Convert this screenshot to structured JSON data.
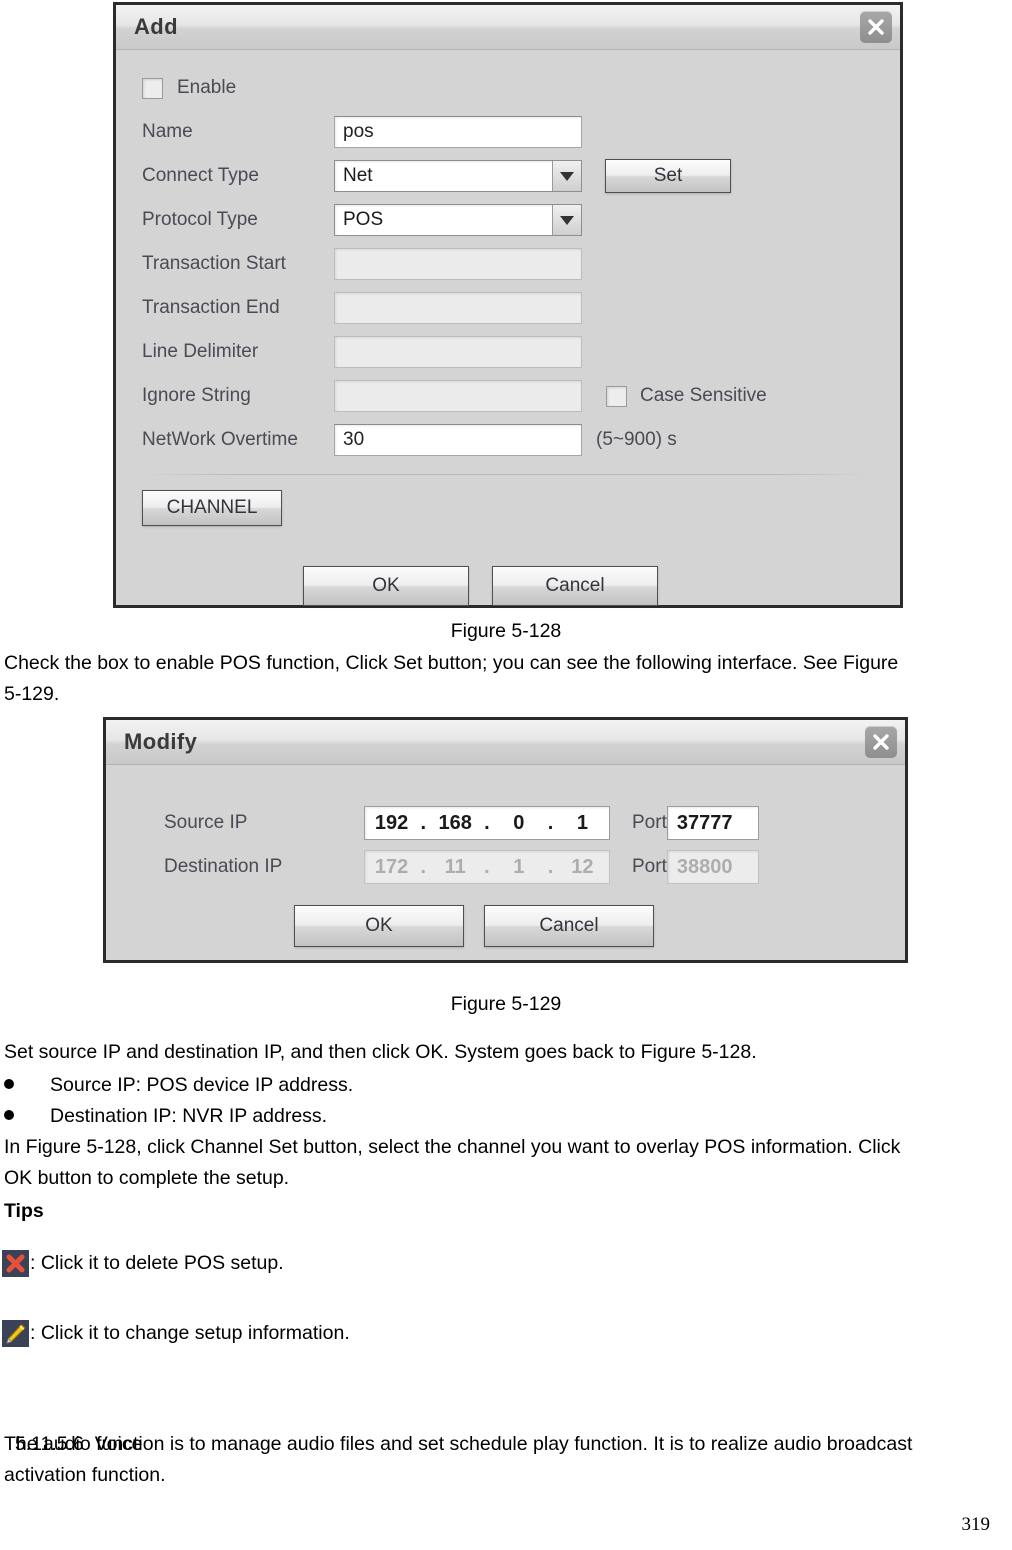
{
  "add_dialog": {
    "title": "Add",
    "close_icon": "close-icon",
    "enable_label": "Enable",
    "fields": {
      "name_label": "Name",
      "name_value": "pos",
      "connect_type_label": "Connect Type",
      "connect_type_value": "Net",
      "set_button": "Set",
      "protocol_type_label": "Protocol Type",
      "protocol_type_value": "POS",
      "transaction_start_label": "Transaction Start",
      "transaction_start_value": "",
      "transaction_end_label": "Transaction End",
      "transaction_end_value": "",
      "line_delimiter_label": "Line Delimiter",
      "line_delimiter_value": "",
      "ignore_string_label": "Ignore String",
      "ignore_string_value": "",
      "case_sensitive_label": "Case Sensitive",
      "network_overtime_label": "NetWork Overtime",
      "network_overtime_value": "30",
      "network_overtime_range": "(5~900) s"
    },
    "channel_button": "CHANNEL",
    "ok_button": "OK",
    "cancel_button": "Cancel"
  },
  "figure_128_caption": "Figure 5-128",
  "body_text_1": "Check the box to enable POS function, Click Set button; you can see the following interface. See Figure",
  "body_text_1b": "5-129.",
  "modify_dialog": {
    "title": "Modify",
    "close_icon": "close-icon",
    "source_ip_label": "Source IP",
    "source_ip": [
      "192",
      "168",
      "0",
      "1"
    ],
    "source_port_label": "Port",
    "source_port": "37777",
    "destination_ip_label": "Destination IP",
    "destination_ip": [
      "172",
      "11",
      "1",
      "12"
    ],
    "destination_port_label": "Port",
    "destination_port": "38800",
    "ok_button": "OK",
    "cancel_button": "Cancel"
  },
  "figure_129_caption": "Figure 5-129",
  "body_text_2": "Set source IP and destination IP, and then click OK. System goes back to Figure 5-128.",
  "bullets": [
    "Source IP: POS device IP address.",
    "Destination IP: NVR IP address."
  ],
  "body_text_3": "In Figure 5-128, click Channel Set button, select the channel you want to overlay POS information. Click",
  "body_text_3b": "OK button to complete the setup.",
  "tips_heading": "Tips",
  "tips": [
    {
      "icon": "delete-x-icon",
      "text": ": Click it to delete POS setup."
    },
    {
      "icon": "edit-pencil-icon",
      "text": ": Click it to change setup information."
    }
  ],
  "section": {
    "number": "5.11.5.6",
    "title": "Voice",
    "paragraph_line1": "The audio function is to manage audio files and set schedule play function. It is to realize audio broadcast",
    "paragraph_line2": "activation function."
  },
  "page_number": "319",
  "colors": {
    "dialog_bg": "#d4d4d4",
    "dialog_border": "#2b2b2b",
    "icon_bg": "#3b4258",
    "delete_x": "#e8503a",
    "pencil": "#f5c518"
  }
}
